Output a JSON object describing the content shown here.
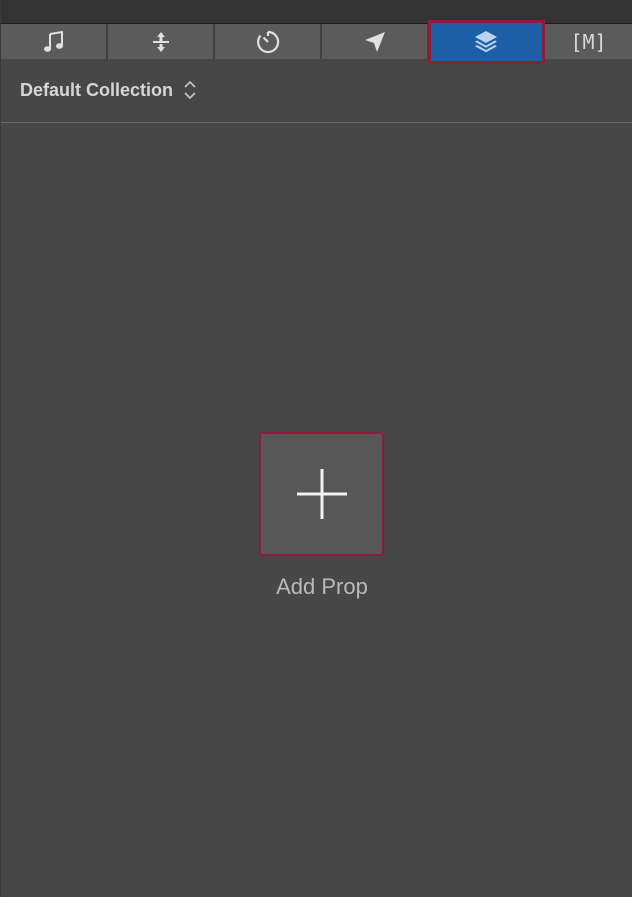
{
  "tabs": [
    {
      "icon": "music-note-icon"
    },
    {
      "icon": "split-divide-icon"
    },
    {
      "icon": "timer-icon"
    },
    {
      "icon": "navigation-arrow-icon"
    },
    {
      "icon": "layers-icon",
      "active": true
    },
    {
      "icon": "marker-bracket-icon",
      "text": "[M]"
    }
  ],
  "collection": {
    "label": "Default Collection",
    "chevron_icon": "up-down-chevron-icon"
  },
  "add_prop": {
    "icon": "plus-icon",
    "label": "Add Prop"
  },
  "colors": {
    "background": "#474747",
    "tab_bar": "#5b5b5b",
    "active_tab": "#1d5fa6",
    "highlight_border": "#8a1e3c"
  }
}
